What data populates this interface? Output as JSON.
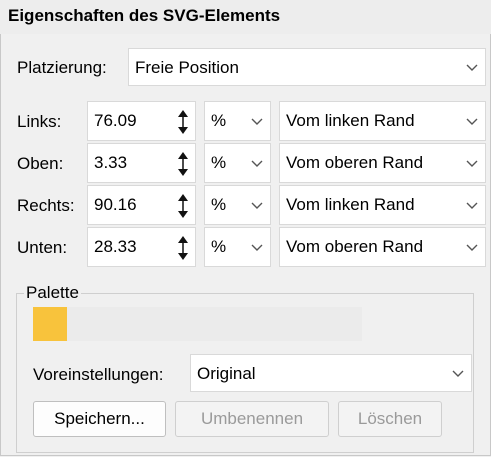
{
  "title": "Eigenschaften des SVG-Elements",
  "placement": {
    "label": "Platzierung:",
    "value": "Freie Position"
  },
  "rows": [
    {
      "label": "Links:",
      "value": "76.09",
      "unit": "%",
      "reference": "Vom linken Rand"
    },
    {
      "label": "Oben:",
      "value": "3.33",
      "unit": "%",
      "reference": "Vom oberen Rand"
    },
    {
      "label": "Rechts:",
      "value": "90.16",
      "unit": "%",
      "reference": "Vom linken Rand"
    },
    {
      "label": "Unten:",
      "value": "28.33",
      "unit": "%",
      "reference": "Vom oberen Rand"
    }
  ],
  "palette": {
    "label": "Palette",
    "swatch_color": "#f8c33c",
    "presets_label": "Voreinstellungen:",
    "presets_value": "Original",
    "buttons": {
      "save": "Speichern...",
      "rename": "Umbenennen",
      "delete": "Löschen"
    }
  }
}
